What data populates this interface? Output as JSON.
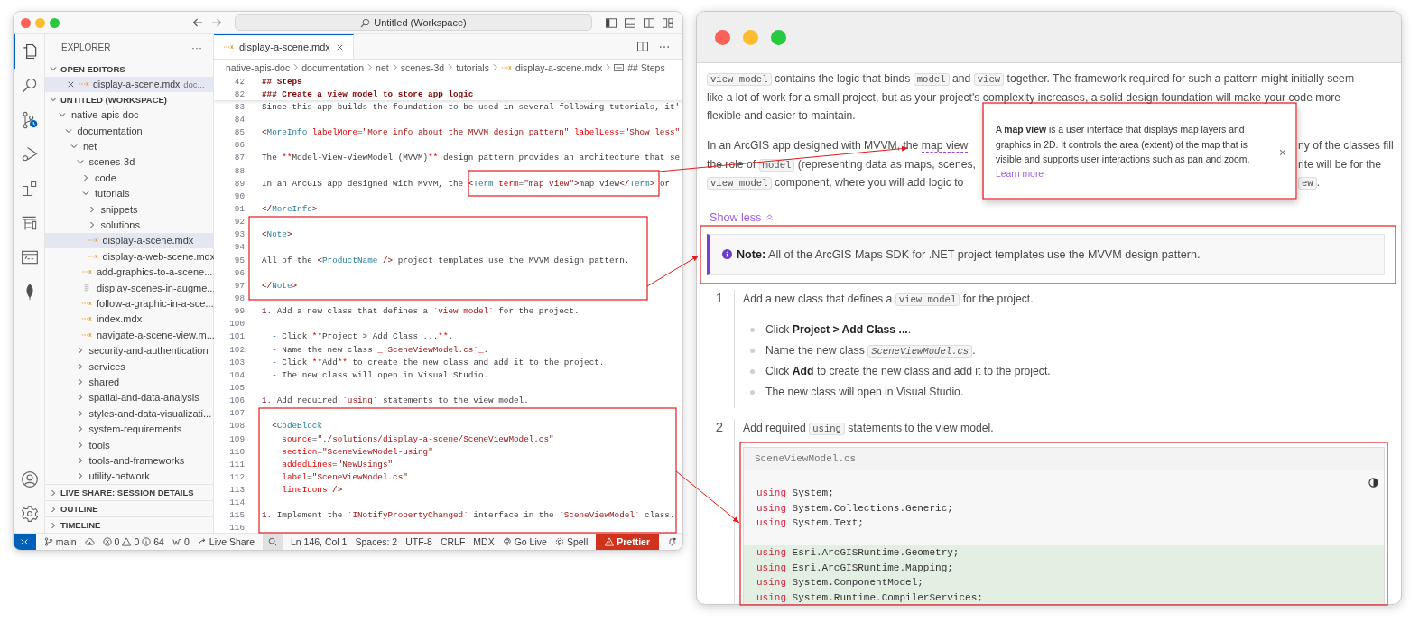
{
  "vscode": {
    "title_bar": {
      "command_center": "Untitled (Workspace)"
    },
    "activity_bar": {
      "top": [
        {
          "kind": "files",
          "selected": true
        },
        {
          "kind": "search",
          "selected": false
        },
        {
          "kind": "source_control",
          "selected": false
        },
        {
          "kind": "run_debug",
          "selected": false
        },
        {
          "kind": "extensions",
          "selected": false
        },
        {
          "kind": "tree",
          "selected": false
        },
        {
          "kind": "api",
          "selected": false
        },
        {
          "kind": "leaf",
          "selected": false
        }
      ],
      "bottom": [
        {
          "kind": "account"
        },
        {
          "kind": "settings"
        }
      ]
    },
    "sidebar": {
      "title": "EXPLORER",
      "more": "···",
      "open_editors": {
        "title": "OPEN EDITORS",
        "expanded": true,
        "items": [
          {
            "label": "display-a-scene.mdx",
            "description": "doc...",
            "selected": true
          }
        ]
      },
      "workspace": {
        "title": "UNTITLED (WORKSPACE)",
        "expanded": true,
        "tree": [
          {
            "label": "native-apis-doc",
            "kind": "folder",
            "expanded": true,
            "selected": false,
            "children": [
              {
                "label": "documentation",
                "kind": "folder",
                "expanded": true,
                "selected": false,
                "children": [
                  {
                    "label": "net",
                    "kind": "folder",
                    "expanded": true,
                    "selected": false,
                    "children": [
                      {
                        "label": "scenes-3d",
                        "kind": "folder",
                        "expanded": true,
                        "selected": false,
                        "children": [
                          {
                            "label": "code",
                            "kind": "folder",
                            "expanded": false,
                            "selected": false
                          },
                          {
                            "label": "tutorials",
                            "kind": "folder",
                            "expanded": true,
                            "selected": false,
                            "children": [
                              {
                                "label": "snippets",
                                "kind": "folder",
                                "expanded": false,
                                "selected": false
                              },
                              {
                                "label": "solutions",
                                "kind": "folder",
                                "expanded": false,
                                "selected": false
                              },
                              {
                                "label": "display-a-scene.mdx",
                                "kind": "mdx",
                                "selected": true
                              },
                              {
                                "label": "display-a-web-scene.mdx",
                                "kind": "mdx",
                                "selected": false
                              }
                            ]
                          },
                          {
                            "label": "add-graphics-to-a-scene...",
                            "kind": "mdx",
                            "selected": false
                          },
                          {
                            "label": "display-scenes-in-augme...",
                            "kind": "doc",
                            "selected": false
                          },
                          {
                            "label": "follow-a-graphic-in-a-sce...",
                            "kind": "mdx",
                            "selected": false
                          },
                          {
                            "label": "index.mdx",
                            "kind": "mdx",
                            "selected": false
                          },
                          {
                            "label": "navigate-a-scene-view.m...",
                            "kind": "mdx",
                            "selected": false
                          }
                        ]
                      },
                      {
                        "label": "security-and-authentication",
                        "kind": "folder",
                        "expanded": false,
                        "selected": false
                      },
                      {
                        "label": "services",
                        "kind": "folder",
                        "expanded": false,
                        "selected": false
                      },
                      {
                        "label": "shared",
                        "kind": "folder",
                        "expanded": false,
                        "selected": false
                      },
                      {
                        "label": "spatial-and-data-analysis",
                        "kind": "folder",
                        "expanded": false,
                        "selected": false
                      },
                      {
                        "label": "styles-and-data-visualizati...",
                        "kind": "folder",
                        "expanded": false,
                        "selected": false
                      },
                      {
                        "label": "system-requirements",
                        "kind": "folder",
                        "expanded": false,
                        "selected": false
                      },
                      {
                        "label": "tools",
                        "kind": "folder",
                        "expanded": false,
                        "selected": false
                      },
                      {
                        "label": "tools-and-frameworks",
                        "kind": "folder",
                        "expanded": false,
                        "selected": false
                      },
                      {
                        "label": "utility-network",
                        "kind": "folder",
                        "expanded": false,
                        "selected": false
                      }
                    ]
                  }
                ]
              }
            ]
          }
        ]
      },
      "sections": [
        {
          "title": "LIVE SHARE: SESSION DETAILS",
          "expanded": false
        },
        {
          "title": "OUTLINE",
          "expanded": false
        },
        {
          "title": "TIMELINE",
          "expanded": false
        }
      ]
    },
    "editor": {
      "tabs": [
        {
          "label": "display-a-scene.mdx",
          "selected": true
        }
      ],
      "breadcrumbs": [
        {
          "text": "native-apis-doc",
          "kind": "folder"
        },
        {
          "text": "documentation",
          "kind": "folder"
        },
        {
          "text": "net",
          "kind": "folder"
        },
        {
          "text": "scenes-3d",
          "kind": "folder"
        },
        {
          "text": "tutorials",
          "kind": "folder"
        },
        {
          "text": "display-a-scene.mdx",
          "kind": "mdx"
        },
        {
          "text": "## Steps",
          "kind": "symbol"
        }
      ],
      "sticky_lines": [
        {
          "number": "42",
          "tokens": [
            {
              "kind": "heading",
              "text": "## Steps"
            }
          ]
        },
        {
          "number": "82",
          "tokens": [
            {
              "kind": "heading",
              "text": "### Create a view model to store app logic"
            }
          ]
        }
      ],
      "lines": [
        {
          "number": "83",
          "tokens": [
            {
              "kind": "plain",
              "text": "Since this app builds the foundation to be used in several following tutorials, it'"
            }
          ]
        },
        {
          "number": "84"
        },
        {
          "number": "85",
          "tokens": [
            {
              "kind": "punct",
              "text": "<"
            },
            {
              "kind": "tag",
              "text": "MoreInfo"
            },
            {
              "kind": "attr",
              "text": " labelMore"
            },
            {
              "kind": "plain",
              "text": "="
            },
            {
              "kind": "string",
              "text": "\"More info about the MVVM design pattern\""
            },
            {
              "kind": "attr",
              "text": " labelLess"
            },
            {
              "kind": "plain",
              "text": "="
            },
            {
              "kind": "string",
              "text": "\"Show less\""
            }
          ]
        },
        {
          "number": "86"
        },
        {
          "number": "87",
          "tokens": [
            {
              "kind": "plain",
              "text": "The "
            },
            {
              "kind": "emphasis",
              "text": "**"
            },
            {
              "kind": "plain",
              "text": "Model-View-ViewModel (MVVM)"
            },
            {
              "kind": "emphasis",
              "text": "**"
            },
            {
              "kind": "plain",
              "text": " design pattern provides an architecture that se"
            }
          ]
        },
        {
          "number": "88"
        },
        {
          "number": "89",
          "tokens": [
            {
              "kind": "plain",
              "text": "In an ArcGIS app designed with MVVM, the "
            },
            {
              "kind": "punct",
              "text": "<"
            },
            {
              "kind": "tag",
              "text": "Term"
            },
            {
              "kind": "attr",
              "text": " term"
            },
            {
              "kind": "plain",
              "text": "="
            },
            {
              "kind": "string",
              "text": "\"map view\""
            },
            {
              "kind": "punct",
              "text": ">"
            },
            {
              "kind": "plain",
              "text": "map view"
            },
            {
              "kind": "punct",
              "text": "</"
            },
            {
              "kind": "tag",
              "text": "Term"
            },
            {
              "kind": "punct",
              "text": ">"
            },
            {
              "kind": "plain",
              "text": " or"
            }
          ]
        },
        {
          "number": "90"
        },
        {
          "number": "91",
          "tokens": [
            {
              "kind": "punct",
              "text": "</"
            },
            {
              "kind": "tag",
              "text": "MoreInfo"
            },
            {
              "kind": "punct",
              "text": ">"
            }
          ]
        },
        {
          "number": "92"
        },
        {
          "number": "93",
          "tokens": [
            {
              "kind": "punct",
              "text": "<"
            },
            {
              "kind": "tag",
              "text": "Note"
            },
            {
              "kind": "punct",
              "text": ">"
            }
          ]
        },
        {
          "number": "94"
        },
        {
          "number": "95",
          "tokens": [
            {
              "kind": "plain",
              "text": "All of the "
            },
            {
              "kind": "punct",
              "text": "<"
            },
            {
              "kind": "tag",
              "text": "ProductName"
            },
            {
              "kind": "punct",
              "text": " />"
            },
            {
              "kind": "plain",
              "text": " project templates use the MVVM design pattern."
            }
          ]
        },
        {
          "number": "96"
        },
        {
          "number": "97",
          "tokens": [
            {
              "kind": "punct",
              "text": "</"
            },
            {
              "kind": "tag",
              "text": "Note"
            },
            {
              "kind": "punct",
              "text": ">"
            }
          ]
        },
        {
          "number": "98"
        },
        {
          "number": "99",
          "tokens": [
            {
              "kind": "marker",
              "text": "1."
            },
            {
              "kind": "plain",
              "text": " Add a new class that defines a "
            },
            {
              "kind": "code",
              "text": "`view model`"
            },
            {
              "kind": "plain",
              "text": " for the project."
            }
          ]
        },
        {
          "number": "100"
        },
        {
          "number": "101",
          "tokens": [
            {
              "kind": "bullet",
              "text": "  -"
            },
            {
              "kind": "plain",
              "text": " Click "
            },
            {
              "kind": "emphasis",
              "text": "**"
            },
            {
              "kind": "plain",
              "text": "Project > Add Class ..."
            },
            {
              "kind": "emphasis",
              "text": "**"
            },
            {
              "kind": "plain",
              "text": "."
            }
          ]
        },
        {
          "number": "102",
          "tokens": [
            {
              "kind": "bullet",
              "text": "  -"
            },
            {
              "kind": "plain",
              "text": " Name the new class "
            },
            {
              "kind": "emphasis",
              "text": "_"
            },
            {
              "kind": "code",
              "text": "`SceneViewModel.cs`"
            },
            {
              "kind": "emphasis",
              "text": "_"
            },
            {
              "kind": "plain",
              "text": "."
            }
          ]
        },
        {
          "number": "103",
          "tokens": [
            {
              "kind": "bullet",
              "text": "  -"
            },
            {
              "kind": "plain",
              "text": " Click "
            },
            {
              "kind": "emphasis",
              "text": "**"
            },
            {
              "kind": "plain",
              "text": "Add"
            },
            {
              "kind": "emphasis",
              "text": "**"
            },
            {
              "kind": "plain",
              "text": " to create the new class and add it to the project."
            }
          ]
        },
        {
          "number": "104",
          "tokens": [
            {
              "kind": "bullet",
              "text": "  -"
            },
            {
              "kind": "plain",
              "text": " The new class will open in Visual Studio."
            }
          ]
        },
        {
          "number": "105"
        },
        {
          "number": "106",
          "tokens": [
            {
              "kind": "marker",
              "text": "1."
            },
            {
              "kind": "plain",
              "text": " Add required "
            },
            {
              "kind": "code",
              "text": "`using`"
            },
            {
              "kind": "plain",
              "text": " statements to the view model."
            }
          ]
        },
        {
          "number": "107"
        },
        {
          "number": "108",
          "tokens": [
            {
              "kind": "punct",
              "text": "  <"
            },
            {
              "kind": "tag",
              "text": "CodeBlock"
            }
          ]
        },
        {
          "number": "109",
          "tokens": [
            {
              "kind": "attr",
              "text": "    source"
            },
            {
              "kind": "plain",
              "text": "="
            },
            {
              "kind": "string",
              "text": "\"./solutions/display-a-scene/SceneViewModel.cs\""
            }
          ]
        },
        {
          "number": "110",
          "tokens": [
            {
              "kind": "attr",
              "text": "    section"
            },
            {
              "kind": "plain",
              "text": "="
            },
            {
              "kind": "string",
              "text": "\"SceneViewModel-using\""
            }
          ]
        },
        {
          "number": "111",
          "tokens": [
            {
              "kind": "attr",
              "text": "    addedLines"
            },
            {
              "kind": "plain",
              "text": "="
            },
            {
              "kind": "string",
              "text": "\"NewUsings\""
            }
          ]
        },
        {
          "number": "112",
          "tokens": [
            {
              "kind": "attr",
              "text": "    label"
            },
            {
              "kind": "plain",
              "text": "="
            },
            {
              "kind": "string",
              "text": "\"SceneViewModel.cs\""
            }
          ]
        },
        {
          "number": "113",
          "tokens": [
            {
              "kind": "attr",
              "text": "    lineIcons"
            },
            {
              "kind": "punct",
              "text": " />"
            }
          ]
        },
        {
          "number": "114"
        },
        {
          "number": "115",
          "tokens": [
            {
              "kind": "marker",
              "text": "1."
            },
            {
              "kind": "plain",
              "text": " Implement the "
            },
            {
              "kind": "code",
              "text": "`INotifyPropertyChanged`"
            },
            {
              "kind": "plain",
              "text": " interface in the "
            },
            {
              "kind": "code",
              "text": "`SceneViewModel`"
            },
            {
              "kind": "plain",
              "text": " class."
            }
          ]
        },
        {
          "number": "116"
        }
      ]
    },
    "status_bar": [
      {
        "kind": "remote"
      },
      {
        "kind": "branch",
        "text": "main"
      },
      {
        "kind": "sync"
      },
      {
        "kind": "problems",
        "errors": "0",
        "warnings": "0",
        "infos": "64"
      },
      {
        "kind": "ports",
        "text": "0"
      },
      {
        "kind": "live_share",
        "text": "Live Share"
      },
      {
        "kind": "search"
      },
      {
        "kind": "text",
        "text": "Ln 146, Col 1"
      },
      {
        "kind": "text",
        "text": "Spaces: 2"
      },
      {
        "kind": "text",
        "text": "UTF-8"
      },
      {
        "kind": "text",
        "text": "CRLF"
      },
      {
        "kind": "text",
        "text": "MDX"
      },
      {
        "kind": "go_live",
        "text": "Go Live"
      },
      {
        "kind": "spell",
        "text": "Spell"
      },
      {
        "kind": "warning",
        "text": "Prettier"
      },
      {
        "kind": "notifications"
      }
    ]
  },
  "doc": {
    "paragraphs": [
      {
        "lines": [
          {
            "segments": [
              {
                "kind": "code",
                "text": "view model"
              },
              {
                "kind": "text",
                "text": " contains the logic that binds "
              },
              {
                "kind": "code",
                "text": "model"
              },
              {
                "kind": "text",
                "text": " and "
              },
              {
                "kind": "code",
                "text": "view"
              },
              {
                "kind": "text",
                "text": " together. The framework required for such a pattern might initially seem"
              }
            ]
          },
          {
            "segments": [
              {
                "kind": "text",
                "text": "like a lot of work for a small project, but as your project's complexity increases, a solid design foundation will make your code more"
              }
            ]
          },
          {
            "segments": [
              {
                "kind": "text",
                "text": "flexible and easier to maintain."
              }
            ]
          }
        ]
      },
      {
        "lines": [
          {
            "segments": [
              {
                "kind": "text",
                "text": "In an ArcGIS app designed with MVVM, the "
              },
              {
                "kind": "term",
                "text": "map view"
              }
            ],
            "after": [
              {
                "kind": "text",
                "text": "ny of the classes fill"
              }
            ]
          },
          {
            "segments": [
              {
                "kind": "text",
                "text": "the role of "
              },
              {
                "kind": "code",
                "text": "model"
              },
              {
                "kind": "text",
                "text": " (representing data as maps, scenes,"
              }
            ],
            "after": [
              {
                "kind": "text",
                "text": "rite will be for the"
              }
            ]
          },
          {
            "segments": [
              {
                "kind": "code",
                "text": "view model"
              },
              {
                "kind": "text",
                "text": " component, where you will add logic to"
              }
            ],
            "after": [
              {
                "kind": "code",
                "text": "ew"
              },
              {
                "kind": "text",
                "text": "."
              }
            ]
          }
        ]
      }
    ],
    "tooltip": {
      "text": "A **map view** is a user interface that displays map layers and graphics in 2D. It controls the area (extent) of the map that is visible and supports user interactions such as pan and zoom.",
      "link": "Learn more",
      "close": "×"
    },
    "toggle": {
      "label": "Show less",
      "expanded": true
    },
    "note": {
      "text": "**Note:** All of the ArcGIS Maps SDK for .NET project templates use the MVVM design pattern."
    },
    "steps": [
      {
        "number": "1",
        "segments": [
          {
            "kind": "text",
            "text": "Add a new class that defines a "
          },
          {
            "kind": "code",
            "text": "view model"
          },
          {
            "kind": "text",
            "text": " for the project."
          }
        ],
        "bullets": [
          [
            {
              "kind": "text",
              "text": "Click "
            },
            {
              "kind": "bold",
              "text": "Project > Add Class ..."
            },
            {
              "kind": "text",
              "text": "."
            }
          ],
          [
            {
              "kind": "text",
              "text": "Name the new class "
            },
            {
              "kind": "code_italic",
              "text": "SceneViewModel.cs"
            },
            {
              "kind": "text",
              "text": "."
            }
          ],
          [
            {
              "kind": "text",
              "text": "Click "
            },
            {
              "kind": "bold",
              "text": "Add"
            },
            {
              "kind": "text",
              "text": " to create the new class and add it to the project."
            }
          ],
          [
            {
              "kind": "text",
              "text": "The new class will open in Visual Studio."
            }
          ]
        ]
      },
      {
        "number": "2",
        "segments": [
          {
            "kind": "text",
            "text": "Add required "
          },
          {
            "kind": "code",
            "text": "using"
          },
          {
            "kind": "text",
            "text": " statements to the view model."
          }
        ],
        "code_block": {
          "title": "SceneViewModel.cs",
          "groups": [
            {
              "added": false,
              "lines": [
                {
                  "keyword": "using",
                  "rest": " System;"
                },
                {
                  "keyword": "using",
                  "rest": " System.Collections.Generic;"
                },
                {
                  "keyword": "using",
                  "rest": " System.Text;"
                }
              ]
            },
            {
              "added": true,
              "lines": [
                {
                  "keyword": "using",
                  "rest": " Esri.ArcGISRuntime.Geometry;"
                },
                {
                  "keyword": "using",
                  "rest": " Esri.ArcGISRuntime.Mapping;"
                },
                {
                  "keyword": "using",
                  "rest": " System.ComponentModel;"
                },
                {
                  "keyword": "using",
                  "rest": " System.Runtime.CompilerServices;"
                }
              ]
            }
          ]
        }
      }
    ]
  }
}
